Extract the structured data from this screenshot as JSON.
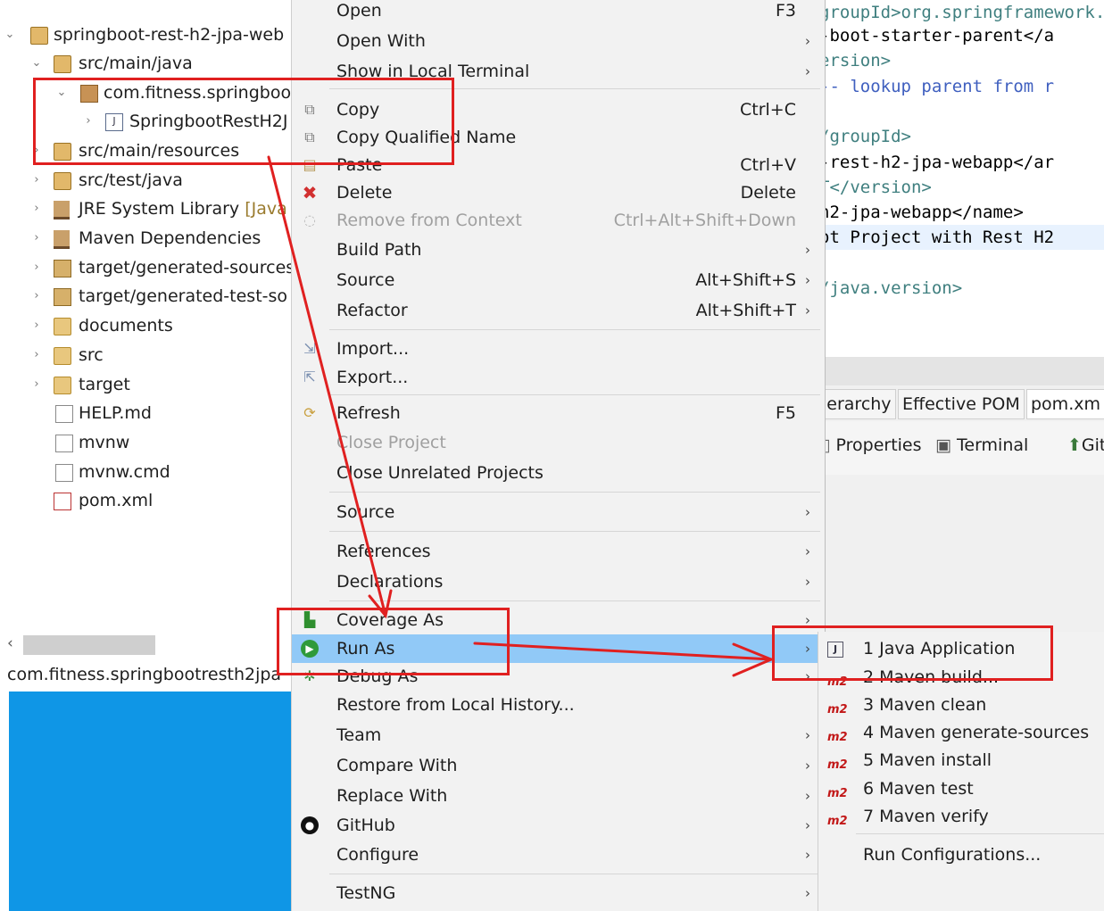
{
  "explorer": {
    "items": [
      {
        "label": "springboot-rest-h2-jpa-web",
        "twisty": "⌄",
        "icon": "maven-project-icon"
      },
      {
        "label": "src/main/java",
        "twisty": "⌄",
        "icon": "source-folder-icon"
      },
      {
        "label": "com.fitness.springboo",
        "twisty": "⌄",
        "icon": "package-icon"
      },
      {
        "label": "SpringbootRestH2J",
        "twisty": "›",
        "icon": "java-file-icon"
      },
      {
        "label": "src/main/resources",
        "twisty": "›",
        "icon": "source-folder-icon"
      },
      {
        "label": "src/test/java",
        "twisty": "›",
        "icon": "source-folder-icon"
      },
      {
        "label": "JRE System Library",
        "decoration": "[Java",
        "twisty": "›",
        "icon": "library-icon"
      },
      {
        "label": "Maven Dependencies",
        "twisty": "›",
        "icon": "library-icon"
      },
      {
        "label": "target/generated-sources",
        "twisty": "›",
        "icon": "generated-folder-icon"
      },
      {
        "label": "target/generated-test-so",
        "twisty": "›",
        "icon": "generated-folder-icon"
      },
      {
        "label": "documents",
        "twisty": "›",
        "icon": "folder-icon"
      },
      {
        "label": "src",
        "twisty": "›",
        "icon": "folder-icon"
      },
      {
        "label": "target",
        "twisty": "›",
        "icon": "folder-icon"
      },
      {
        "label": "HELP.md",
        "twisty": "",
        "icon": "markdown-file-icon"
      },
      {
        "label": "mvnw",
        "twisty": "",
        "icon": "binary-file-icon"
      },
      {
        "label": "mvnw.cmd",
        "twisty": "",
        "icon": "text-file-icon"
      },
      {
        "label": "pom.xml",
        "twisty": "",
        "icon": "pom-file-icon"
      }
    ],
    "status_package": "com.fitness.springbootresth2jpa",
    "scroll_left_glyph": "‹"
  },
  "editor": {
    "lines": [
      {
        "text": "groupId>org.springframework.boot</groupId>",
        "kind": "tag"
      },
      {
        "text": "-boot-starter-parent</a",
        "kind": "text"
      },
      {
        "text": "ersion>",
        "kind": "tag"
      },
      {
        "text": "-- lookup parent from r",
        "kind": "comment"
      },
      {
        "text": "",
        "kind": "text"
      },
      {
        "text": "/groupId>",
        "kind": "tag"
      },
      {
        "text": "-rest-h2-jpa-webapp</ar",
        "kind": "text"
      },
      {
        "text": "T</version>",
        "kind": "tag"
      },
      {
        "text": "h2-jpa-webapp</name>",
        "kind": "text"
      },
      {
        "text": "ot Project with Rest H2",
        "kind": "text"
      },
      {
        "text": "",
        "kind": "text"
      },
      {
        "text": "/java.version>",
        "kind": "tag"
      }
    ],
    "tabs": [
      "ierarchy",
      "Effective POM",
      "pom.xm"
    ],
    "views": [
      "Properties",
      "Terminal",
      "Git"
    ]
  },
  "context_menu": {
    "items": [
      {
        "label": "Open",
        "accel": "F3"
      },
      {
        "label": "Open With",
        "submenu": true
      },
      {
        "label": "Show in Local Terminal",
        "submenu": true
      },
      {
        "label": "Copy",
        "accel": "Ctrl+C",
        "icon": "copy-icon"
      },
      {
        "label": "Copy Qualified Name",
        "icon": "copy-qualified-icon"
      },
      {
        "label": "Paste",
        "accel": "Ctrl+V",
        "icon": "paste-icon"
      },
      {
        "label": "Delete",
        "accel": "Delete",
        "icon": "delete-icon"
      },
      {
        "label": "Remove from Context",
        "accel": "Ctrl+Alt+Shift+Down",
        "disabled": true,
        "icon": "remove-context-icon"
      },
      {
        "label": "Build Path",
        "submenu": true
      },
      {
        "label": "Source",
        "accel": "Alt+Shift+S",
        "submenu": true
      },
      {
        "label": "Refactor",
        "accel": "Alt+Shift+T",
        "submenu": true
      },
      {
        "label": "Import...",
        "icon": "import-icon"
      },
      {
        "label": "Export...",
        "icon": "export-icon"
      },
      {
        "label": "Refresh",
        "accel": "F5",
        "icon": "refresh-icon"
      },
      {
        "label": "Close Project",
        "disabled": true
      },
      {
        "label": "Close Unrelated Projects"
      },
      {
        "label": "Source",
        "submenu": true
      },
      {
        "label": "References",
        "submenu": true
      },
      {
        "label": "Declarations",
        "submenu": true
      },
      {
        "label": "Coverage As",
        "submenu": true,
        "icon": "coverage-icon"
      },
      {
        "label": "Run As",
        "submenu": true,
        "active": true,
        "icon": "run-icon"
      },
      {
        "label": "Debug As",
        "submenu": true,
        "icon": "debug-icon"
      },
      {
        "label": "Restore from Local History..."
      },
      {
        "label": "Team",
        "submenu": true
      },
      {
        "label": "Compare With",
        "submenu": true
      },
      {
        "label": "Replace With",
        "submenu": true
      },
      {
        "label": "GitHub",
        "submenu": true,
        "icon": "github-icon"
      },
      {
        "label": "Configure",
        "submenu": true
      },
      {
        "label": "TestNG",
        "submenu": true
      }
    ],
    "submenu_arrow": "›"
  },
  "run_as_submenu": {
    "items": [
      {
        "label": "1 Java Application",
        "icon": "java-app-icon"
      },
      {
        "label": "2 Maven build...",
        "icon": "m2-icon"
      },
      {
        "label": "3 Maven clean",
        "icon": "m2-icon"
      },
      {
        "label": "4 Maven generate-sources",
        "icon": "m2-icon"
      },
      {
        "label": "5 Maven install",
        "icon": "m2-icon"
      },
      {
        "label": "6 Maven test",
        "icon": "m2-icon"
      },
      {
        "label": "7 Maven verify",
        "icon": "m2-icon"
      },
      {
        "label": "Run Configurations..."
      }
    ],
    "m2_glyph": "m2",
    "java_app_glyph": "J"
  },
  "colors": {
    "annotation_red": "#e02020",
    "menu_highlight": "#91c9f7",
    "desktop_blue": "#0f96e6"
  }
}
